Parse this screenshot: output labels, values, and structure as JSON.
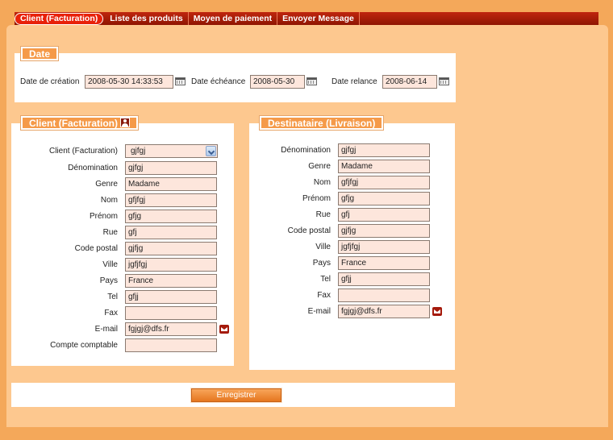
{
  "nav": {
    "tabs": [
      {
        "label": "Client (Facturation)"
      },
      {
        "label": "Liste des produits"
      },
      {
        "label": "Moyen de paiement"
      },
      {
        "label": "Envoyer Message"
      }
    ]
  },
  "date_section": {
    "title": "Date",
    "creation_label": "Date de création",
    "creation_value": "2008-05-30 14:33:53",
    "echeance_label": "Date échéance",
    "echeance_value": "2008-05-30",
    "relance_label": "Date relance",
    "relance_value": "2008-06-14"
  },
  "client": {
    "title": "Client (Facturation)",
    "select_label": "Client (Facturation)",
    "select_value": "gjfgj",
    "fields": [
      {
        "label": "Dénomination",
        "value": "gjfgj"
      },
      {
        "label": "Genre",
        "value": "Madame"
      },
      {
        "label": "Nom",
        "value": "gfjfgj"
      },
      {
        "label": "Prénom",
        "value": "gfjg"
      },
      {
        "label": "Rue",
        "value": "gfj"
      },
      {
        "label": "Code postal",
        "value": "gjfjg"
      },
      {
        "label": "Ville",
        "value": "jgfjfgj"
      },
      {
        "label": "Pays",
        "value": "France"
      },
      {
        "label": "Tel",
        "value": "gfjj"
      },
      {
        "label": "Fax",
        "value": ""
      },
      {
        "label": "E-mail",
        "value": "fgjgj@dfs.fr"
      },
      {
        "label": "Compte comptable",
        "value": ""
      }
    ]
  },
  "destinataire": {
    "title": "Destinataire (Livraison)",
    "fields": [
      {
        "label": "Dénomination",
        "value": "gjfgj"
      },
      {
        "label": "Genre",
        "value": "Madame"
      },
      {
        "label": "Nom",
        "value": "gfjfgj"
      },
      {
        "label": "Prénom",
        "value": "gfjg"
      },
      {
        "label": "Rue",
        "value": "gfj"
      },
      {
        "label": "Code postal",
        "value": "gjfjg"
      },
      {
        "label": "Ville",
        "value": "jgfjfgj"
      },
      {
        "label": "Pays",
        "value": "France"
      },
      {
        "label": "Tel",
        "value": "gfjj"
      },
      {
        "label": "Fax",
        "value": ""
      },
      {
        "label": "E-mail",
        "value": "fgjgj@dfs.fr"
      }
    ]
  },
  "actions": {
    "save_label": "Enregistrer"
  },
  "icons": {
    "calendar": "calendar-icon",
    "mail": "mail-icon",
    "person": "person-icon",
    "dropdown": "chevron-down-icon"
  },
  "colors": {
    "background": "#F4A85A",
    "content": "#FDC88F",
    "nav": "#A51A0C",
    "legend": "#F59A49",
    "field": "#FDE6DC"
  }
}
